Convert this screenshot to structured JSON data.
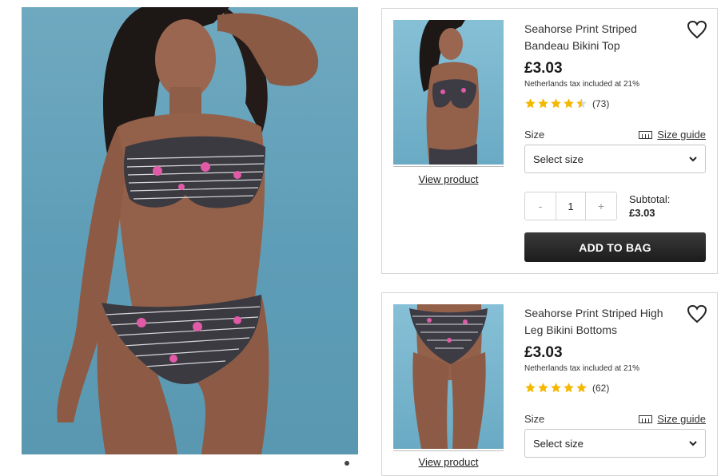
{
  "products": [
    {
      "title": "Seahorse Print Striped Bandeau Bikini Top",
      "price": "£3.03",
      "tax_note": "Netherlands tax included at 21%",
      "rating": 4.5,
      "rating_count": "(73)",
      "view_label": "View product",
      "size_label": "Size",
      "size_guide_label": "Size guide",
      "size_select_value": "Select size",
      "quantity": "1",
      "qty_minus": "-",
      "qty_plus": "+",
      "subtotal_label": "Subtotal:",
      "subtotal_value": "£3.03",
      "add_to_bag_label": "ADD TO BAG"
    },
    {
      "title": "Seahorse Print Striped High Leg Bikini Bottoms",
      "price": "£3.03",
      "tax_note": "Netherlands tax included at 21%",
      "rating": 5,
      "rating_count": "(62)",
      "view_label": "View product",
      "size_label": "Size",
      "size_guide_label": "Size guide",
      "size_select_value": "Select size"
    }
  ],
  "icons": {
    "wishlist": "heart-outline-icon",
    "star": "star-icon",
    "ruler": "ruler-icon",
    "select": "chevron-down-icon"
  },
  "colors": {
    "star": "#f5b800",
    "button": "#222222",
    "hero_bg": "#6fa9c0"
  }
}
